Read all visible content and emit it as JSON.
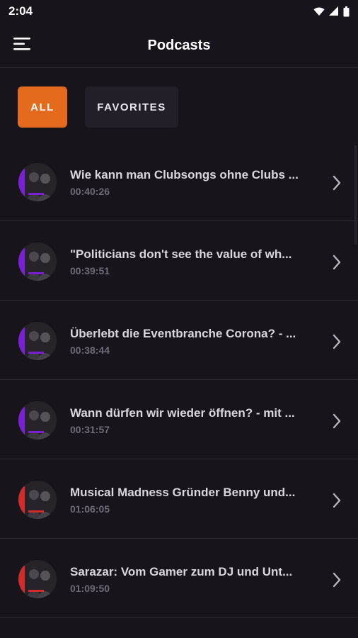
{
  "status": {
    "time": "2:04",
    "icons": [
      "wifi-icon",
      "signal-icon",
      "battery-icon"
    ]
  },
  "header": {
    "title": "Podcasts",
    "menu_icon": "menu-icon"
  },
  "filters": {
    "all_label": "ALL",
    "favorites_label": "FAVORITES",
    "active": "ALL"
  },
  "colors": {
    "background": "#17141c",
    "accent": "#e46a1e",
    "chip_inactive": "#221f29",
    "title_text": "#d9d6de",
    "duration_text": "#6f6b78"
  },
  "episodes": [
    {
      "title": "Wie kann man Clubsongs ohne Clubs ...",
      "duration": "00:40:26",
      "accent": "#7a1fd6"
    },
    {
      "title": "\"Politicians don't see the value of wh...",
      "duration": "00:39:51",
      "accent": "#7a1fd6"
    },
    {
      "title": "Überlebt die Eventbranche Corona? - ...",
      "duration": "00:38:44",
      "accent": "#7a1fd6"
    },
    {
      "title": "Wann dürfen wir wieder öffnen? - mit ...",
      "duration": "00:31:57",
      "accent": "#7a1fd6"
    },
    {
      "title": "Musical Madness Gründer Benny und...",
      "duration": "01:06:05",
      "accent": "#d42a2a"
    },
    {
      "title": "Sarazar: Vom Gamer zum DJ und Unt...",
      "duration": "01:09:50",
      "accent": "#d42a2a"
    }
  ]
}
